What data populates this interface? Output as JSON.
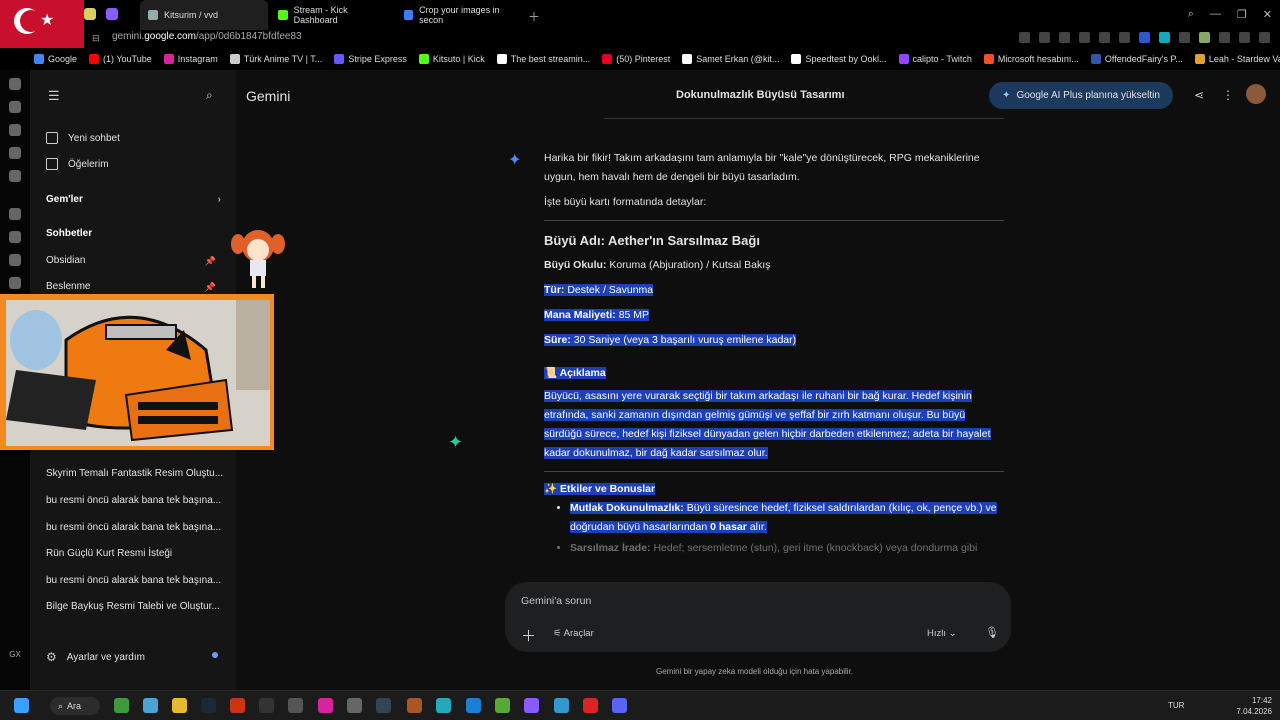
{
  "browser": {
    "tabs": [
      {
        "label": "Kitsurim / vvd",
        "color": "#9aa"
      },
      {
        "label": "Stream - Kick Dashboard",
        "color": "#53fc18"
      },
      {
        "label": "Crop your images in secon",
        "color": "#3d7bff"
      }
    ],
    "url_prefix": "gemini.",
    "url_host": "google.com",
    "url_path": "/app/0d6b1847bfdfee83",
    "bookmarks": [
      {
        "label": "Google",
        "color": "#4285f4"
      },
      {
        "label": "(1) YouTube",
        "color": "#ff0000"
      },
      {
        "label": "Instagram",
        "color": "#d6249f"
      },
      {
        "label": "Türk Anime TV | T...",
        "color": "#cccccc"
      },
      {
        "label": "Stripe Express",
        "color": "#635bff"
      },
      {
        "label": "Kitsuto | Kick",
        "color": "#53fc18"
      },
      {
        "label": "The best streamin...",
        "color": "#ffffff"
      },
      {
        "label": "(50) Pinterest",
        "color": "#e60023"
      },
      {
        "label": "Samet Erkan (@kit...",
        "color": "#ffffff"
      },
      {
        "label": "Speedtest by Ookl...",
        "color": "#ffffff"
      },
      {
        "label": "calipto - Twitch",
        "color": "#9146ff"
      },
      {
        "label": "Microsoft hesabını...",
        "color": "#f25022"
      },
      {
        "label": "OffendedFairy's P...",
        "color": "#3355aa"
      },
      {
        "label": "Leah - Stardew Va...",
        "color": "#e0a030"
      }
    ]
  },
  "sidebar": {
    "new_chat": "Yeni sohbet",
    "items_label": "Öğelerim",
    "gems": "Gem'ler",
    "chats_heading": "Sohbetler",
    "pinned": [
      "Obsidian",
      "Beslenme"
    ],
    "recent": [
      "Skyrim Temalı Fantastik Resim Oluştu...",
      "bu resmi öncü alarak bana tek başına...",
      "bu resmi öncü alarak bana tek başına...",
      "Rün Güçlü Kurt Resmi İsteği",
      "bu resmi öncü alarak bana tek başına...",
      "Bilge Baykuş Resmi Talebi ve Oluştur..."
    ],
    "settings": "Ayarlar ve yardım"
  },
  "header": {
    "brand": "Gemini",
    "title": "Dokunulmazlık Büyüsü Tasarımı",
    "upgrade": "Google AI Plus planına yükseltin"
  },
  "response": {
    "intro": "Harika bir fikir! Takım arkadaşını tam anlamıyla bir \"kale\"ye dönüştürecek, RPG mekaniklerine uygun, hem havalı hem de dengeli bir büyü tasarladım.",
    "format_note": "İşte büyü kartı formatında detaylar:",
    "spell_title": "Büyü Adı: Aether'ın Sarsılmaz Bağı",
    "school_label": "Büyü Okulu:",
    "school_value": "Koruma (Abjuration) / Kutsal Bakış",
    "type_label": "Tür:",
    "type_value": "Destek / Savunma",
    "mana_label": "Mana Maliyeti:",
    "mana_value": "85 MP",
    "duration_label": "Süre:",
    "duration_value": "30 Saniye (veya 3 başarılı vuruş emilene kadar)",
    "desc_heading": "📜 Açıklama",
    "description": "Büyücü, asasını yere vurarak seçtiği bir takım arkadaşı ile ruhani bir bağ kurar. Hedef kişinin etrafında, sanki zamanın dışından gelmiş gümüşi ve şeffaf bir zırh katmanı oluşur. Bu büyü sürdüğü sürece, hedef kişi fiziksel dünyadan gelen hiçbir darbeden etkilenmez; adeta bir hayalet kadar dokunulmaz, bir dağ kadar sarsılmaz olur.",
    "effects_heading": "✨ Etkiler ve Bonuslar",
    "effect1_label": "Mutlak Dokunulmazlık:",
    "effect1_text": "Büyü süresince hedef, fiziksel saldırılardan (kılıç, ok, pençe vb.) ve doğrudan büyü hasarlarından",
    "effect1_bold": "0 hasar",
    "effect1_end": "alır.",
    "effect2_label": "Sarsılmaz İrade:",
    "effect2_text": "Hedef; sersemletme (stun), geri itme (knockback) veya dondurma gibi"
  },
  "input": {
    "placeholder": "Gemini'a sorun",
    "tools": "Araçlar",
    "mode": "Hızlı",
    "disclaimer": "Gemini bir yapay zeka modeli olduğu için hata yapabilir."
  },
  "taskbar": {
    "search": "Ara",
    "lang": "TUR",
    "time": "17:42",
    "date": "7.04.2026",
    "gx": "GX"
  }
}
